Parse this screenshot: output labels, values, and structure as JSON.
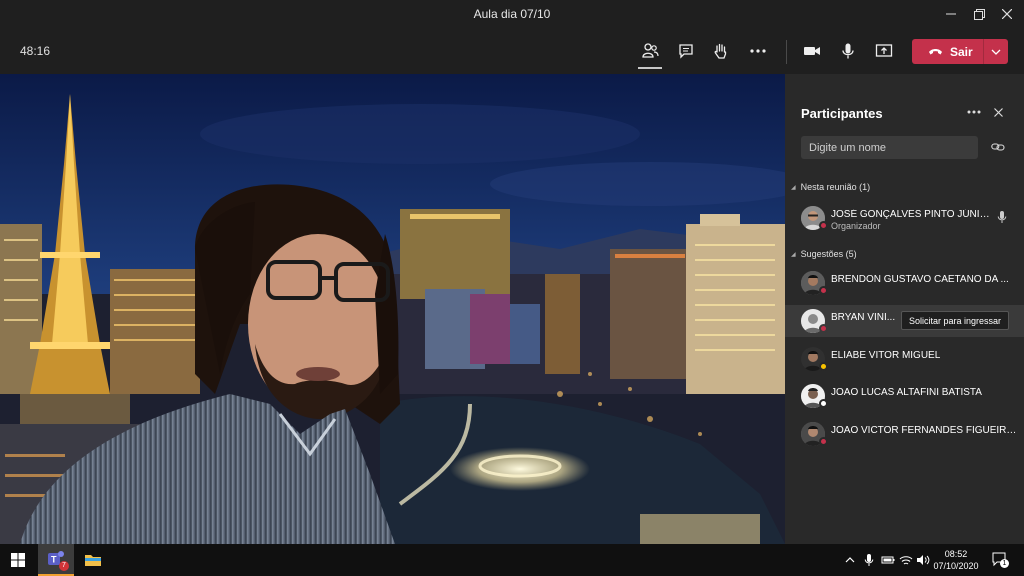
{
  "window": {
    "title": "Aula dia 07/10"
  },
  "toolbar": {
    "timer": "48:16",
    "leave_label": "Sair",
    "icons": [
      "participants-icon",
      "chat-icon",
      "raise-hand-icon",
      "more-actions-icon",
      "camera-icon",
      "microphone-icon",
      "share-screen-icon",
      "leave-phone-icon",
      "chevron-down-icon"
    ]
  },
  "panel": {
    "title": "Participantes",
    "search_placeholder": "Digite um nome",
    "in_meeting_label": "Nesta reunião (1)",
    "suggestions_label": "Sugestões (5)",
    "request_label": "Solicitar para ingressar",
    "in_meeting": [
      {
        "name": "JOSÉ GONÇALVES PINTO JÚNIOR",
        "role": "Organizador",
        "status_color": "#c4314b"
      }
    ],
    "suggestions": [
      {
        "name": "BRENDON GUSTAVO CAETANO DA ...",
        "status_color": "#c4314b"
      },
      {
        "name": "BRYAN VINI...",
        "status_color": "#c4314b"
      },
      {
        "name": "ELIABE VITOR MIGUEL",
        "status_color": "#f8c200"
      },
      {
        "name": "JOAO LUCAS ALTAFINI BATISTA",
        "status_color": "#ffffff"
      },
      {
        "name": "JOAO VICTOR FERNANDES FIGUEIRE...",
        "status_color": "#c4314b"
      }
    ]
  },
  "taskbar": {
    "time": "08:52",
    "date": "07/10/2020",
    "teams_badge": "7",
    "notification_count": "1"
  },
  "colors": {
    "accent_leave": "#c4314b",
    "panel_bg": "#292929",
    "chrome_bg": "#1f1f1f"
  }
}
